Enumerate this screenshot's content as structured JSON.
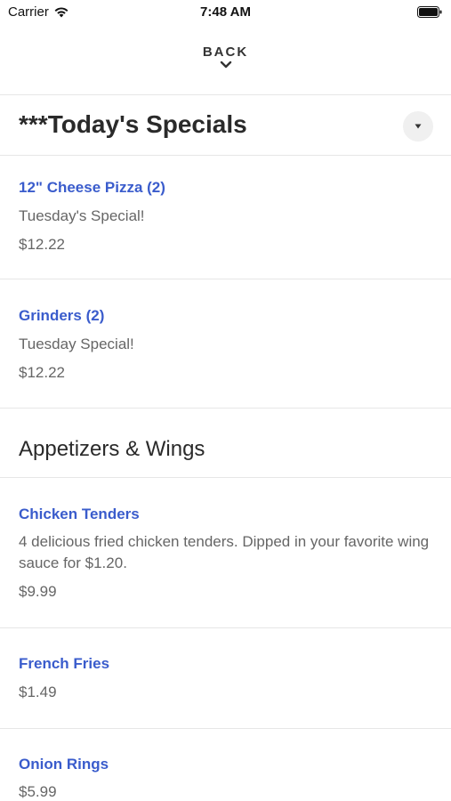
{
  "status_bar": {
    "carrier": "Carrier",
    "time": "7:48 AM"
  },
  "nav": {
    "back_label": "BACK"
  },
  "sections": [
    {
      "title": "***Today's Specials",
      "items": [
        {
          "name": "12\" Cheese Pizza (2)",
          "description": "Tuesday's Special!",
          "price": "$12.22"
        },
        {
          "name": "Grinders (2)",
          "description": "Tuesday Special!",
          "price": "$12.22"
        }
      ]
    },
    {
      "title": "Appetizers & Wings",
      "items": [
        {
          "name": "Chicken Tenders",
          "description": "4 delicious fried chicken tenders. Dipped in your favorite wing sauce for $1.20.",
          "price": "$9.99"
        },
        {
          "name": "French Fries",
          "price": "$1.49"
        },
        {
          "name": "Onion Rings",
          "price": "$5.99"
        }
      ]
    }
  ],
  "colors": {
    "item_name": "#3a5ccc",
    "text_muted": "#666666",
    "divider": "#e6e6e6"
  }
}
